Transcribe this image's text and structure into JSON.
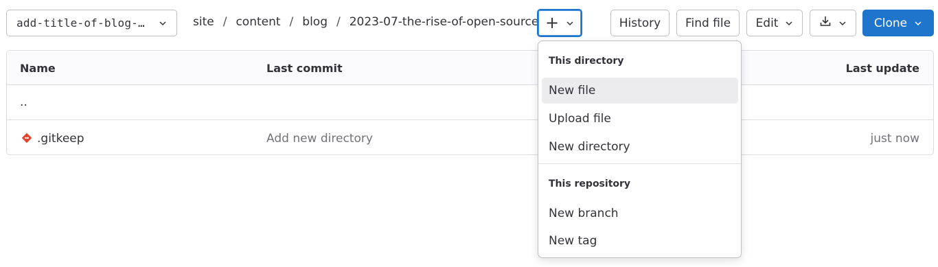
{
  "toolbar": {
    "branch": "add-title-of-blog-…",
    "breadcrumb": [
      "site",
      "content",
      "blog",
      "2023-07-the-rise-of-open-source"
    ],
    "breadcrumb_separator": "/",
    "plus_label": "+",
    "history_label": "History",
    "find_file_label": "Find file",
    "edit_label": "Edit",
    "clone_label": "Clone"
  },
  "table": {
    "headers": {
      "name": "Name",
      "last_commit": "Last commit",
      "last_update": "Last update"
    },
    "rows": [
      {
        "name": "..",
        "commit": "",
        "updated": ""
      },
      {
        "name": ".gitkeep",
        "commit": "Add new directory",
        "updated": "just now"
      }
    ]
  },
  "dropdown": {
    "section1_title": "This directory",
    "section1_items": [
      "New file",
      "Upload file",
      "New directory"
    ],
    "section2_title": "This repository",
    "section2_items": [
      "New branch",
      "New tag"
    ],
    "highlighted_item": "New file"
  },
  "colors": {
    "accent": "#1f75cb",
    "gitkeep_icon": "#e24329"
  }
}
